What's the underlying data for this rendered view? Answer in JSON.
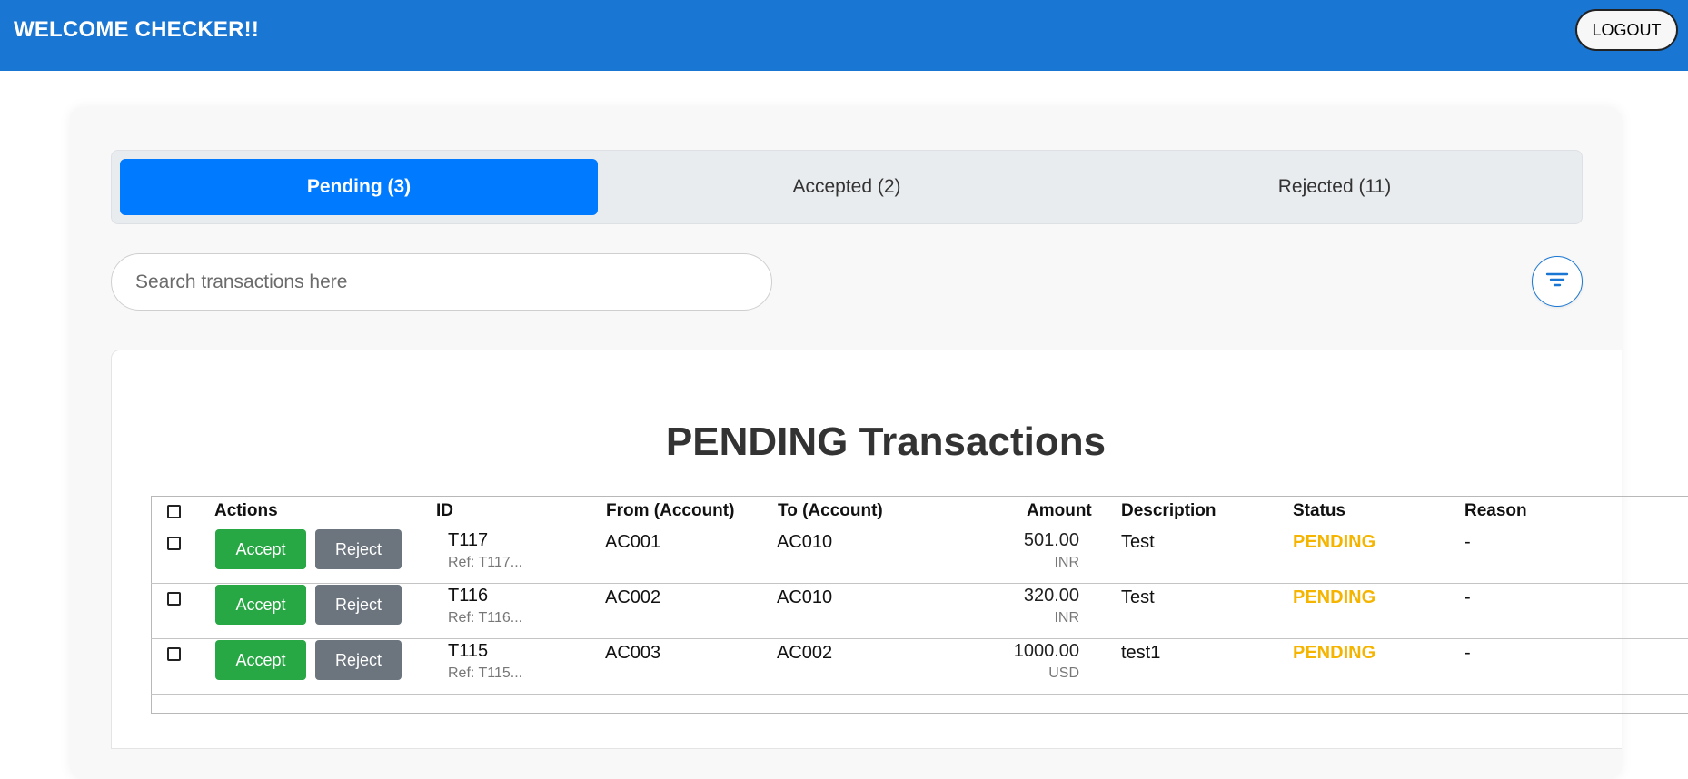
{
  "header": {
    "welcome": "WELCOME CHECKER!!",
    "logout_label": "LOGOUT",
    "bg_color": "#1976d2"
  },
  "tabs": [
    {
      "label": "Pending (3)",
      "active": true
    },
    {
      "label": "Accepted (2)",
      "active": false
    },
    {
      "label": "Rejected (11)",
      "active": false
    }
  ],
  "search": {
    "placeholder": "Search transactions here",
    "value": ""
  },
  "filter": {
    "icon": "filter-icon"
  },
  "panel": {
    "title": "PENDING Transactions"
  },
  "table": {
    "columns": [
      "Actions",
      "ID",
      "From (Account)",
      "To (Account)",
      "Amount",
      "Description",
      "Status",
      "Reason"
    ],
    "accept_label": "Accept",
    "reject_label": "Reject",
    "rows": [
      {
        "id": "T117",
        "ref": "Ref: T117...",
        "from": "AC001",
        "to": "AC010",
        "amount": "501.00",
        "currency": "INR",
        "description": "Test",
        "status": "PENDING",
        "reason": "-"
      },
      {
        "id": "T116",
        "ref": "Ref: T116...",
        "from": "AC002",
        "to": "AC010",
        "amount": "320.00",
        "currency": "INR",
        "description": "Test",
        "status": "PENDING",
        "reason": "-"
      },
      {
        "id": "T115",
        "ref": "Ref: T115...",
        "from": "AC003",
        "to": "AC002",
        "amount": "1000.00",
        "currency": "USD",
        "description": "test1",
        "status": "PENDING",
        "reason": "-"
      }
    ]
  },
  "colors": {
    "accept": "#28a745",
    "reject": "#6c757d",
    "status_pending": "#f4b400",
    "tab_active": "#007bff"
  }
}
